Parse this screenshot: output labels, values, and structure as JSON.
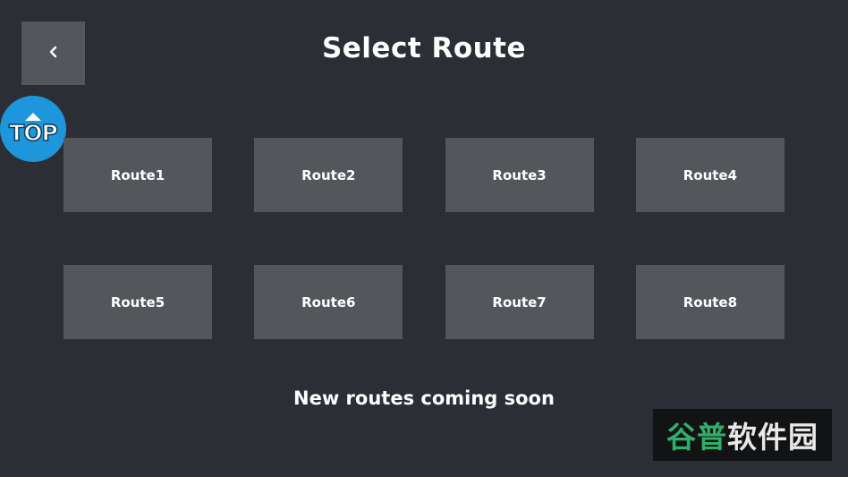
{
  "header": {
    "title": "Select Route"
  },
  "top_badge": {
    "label": "TOP"
  },
  "routes": [
    {
      "label": "Route1"
    },
    {
      "label": "Route2"
    },
    {
      "label": "Route3"
    },
    {
      "label": "Route4"
    },
    {
      "label": "Route5"
    },
    {
      "label": "Route6"
    },
    {
      "label": "Route7"
    },
    {
      "label": "Route8"
    }
  ],
  "footer": {
    "message": "New routes coming soon"
  },
  "watermark": {
    "part1": "谷普",
    "part2": "软件园"
  },
  "icons": {
    "back": "chevron-left-icon",
    "top": "arrow-up-icon"
  },
  "colors": {
    "background": "#2b2f35",
    "button": "#53575c",
    "top_badge": "#1e96dc",
    "text": "#ffffff"
  }
}
